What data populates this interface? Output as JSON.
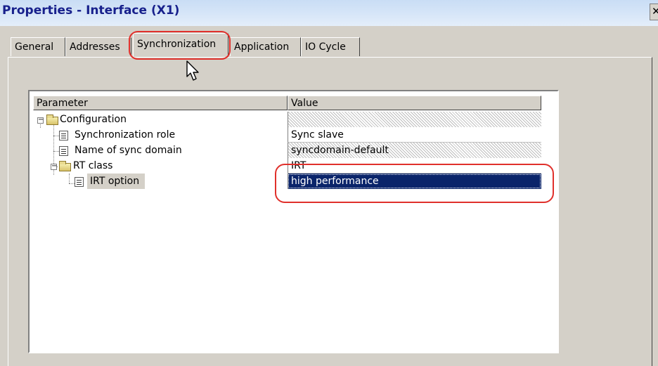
{
  "window": {
    "title": "Properties - Interface (X1)",
    "close_glyph": "✕"
  },
  "tabs": [
    {
      "label": "General",
      "active": false
    },
    {
      "label": "Addresses",
      "active": false
    },
    {
      "label": "Synchronization",
      "active": true
    },
    {
      "label": "Application",
      "active": false
    },
    {
      "label": "IO Cycle",
      "active": false
    }
  ],
  "grid": {
    "headers": {
      "parameter": "Parameter",
      "value": "Value"
    },
    "rows": [
      {
        "label": "Configuration",
        "value": "",
        "icon": "folder-icon",
        "expander": "−"
      },
      {
        "label": "Synchronization role",
        "value": "Sync slave",
        "icon": "parameter-icon"
      },
      {
        "label": "Name of sync domain",
        "value": "syncdomain-default",
        "icon": "parameter-icon"
      },
      {
        "label": "RT class",
        "value": "IRT",
        "icon": "folder-icon",
        "expander": "−"
      },
      {
        "label": "IRT option",
        "value": "high performance",
        "icon": "parameter-icon",
        "selected": true
      }
    ]
  },
  "annotations": {
    "highlight_color": "#e0302b"
  },
  "colors": {
    "selection": "#0a246a",
    "title_text": "#17208c",
    "dialog_face": "#d4d0c8"
  }
}
